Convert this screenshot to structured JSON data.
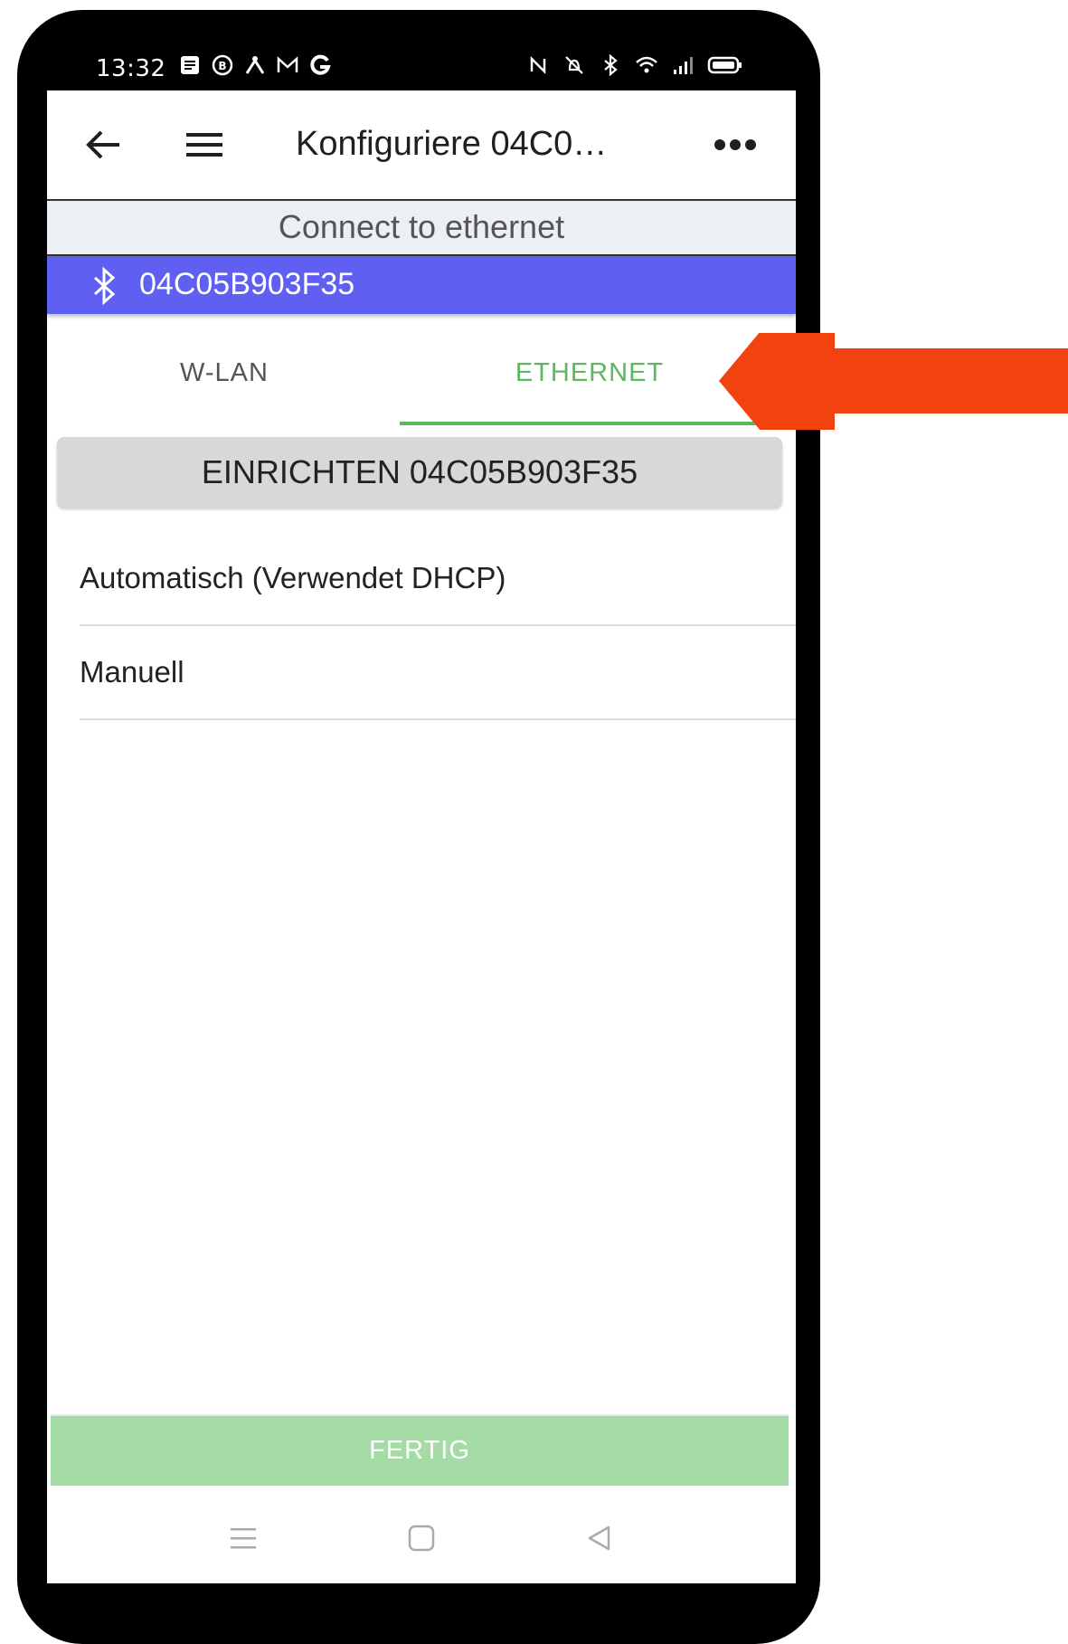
{
  "status_bar": {
    "time": "13:32",
    "left_icons": [
      "notes-icon",
      "b-circle-icon",
      "network-icon",
      "mail-icon",
      "google-icon"
    ],
    "right_icons": [
      "nfc-icon",
      "vibrate-off-icon",
      "bluetooth-icon",
      "wifi-icon",
      "signal-icon",
      "battery-icon"
    ]
  },
  "appbar": {
    "title": "Konfiguriere 04C0…"
  },
  "subheader": "Connect to ethernet",
  "device": {
    "label": "04C05B903F35",
    "color": "#5f5ff2"
  },
  "tabs": [
    {
      "label": "W-LAN",
      "active": false
    },
    {
      "label": "ETHERNET",
      "active": true
    }
  ],
  "setup_button": "EINRICHTEN 04C05B903F35",
  "options": [
    {
      "label": "Automatisch (Verwendet DHCP)"
    },
    {
      "label": "Manuell"
    }
  ],
  "done_button": "FERTIG",
  "colors": {
    "accent_green": "#5cb85c",
    "done_green": "#a5dca5",
    "annotation_arrow": "#f2420f"
  }
}
